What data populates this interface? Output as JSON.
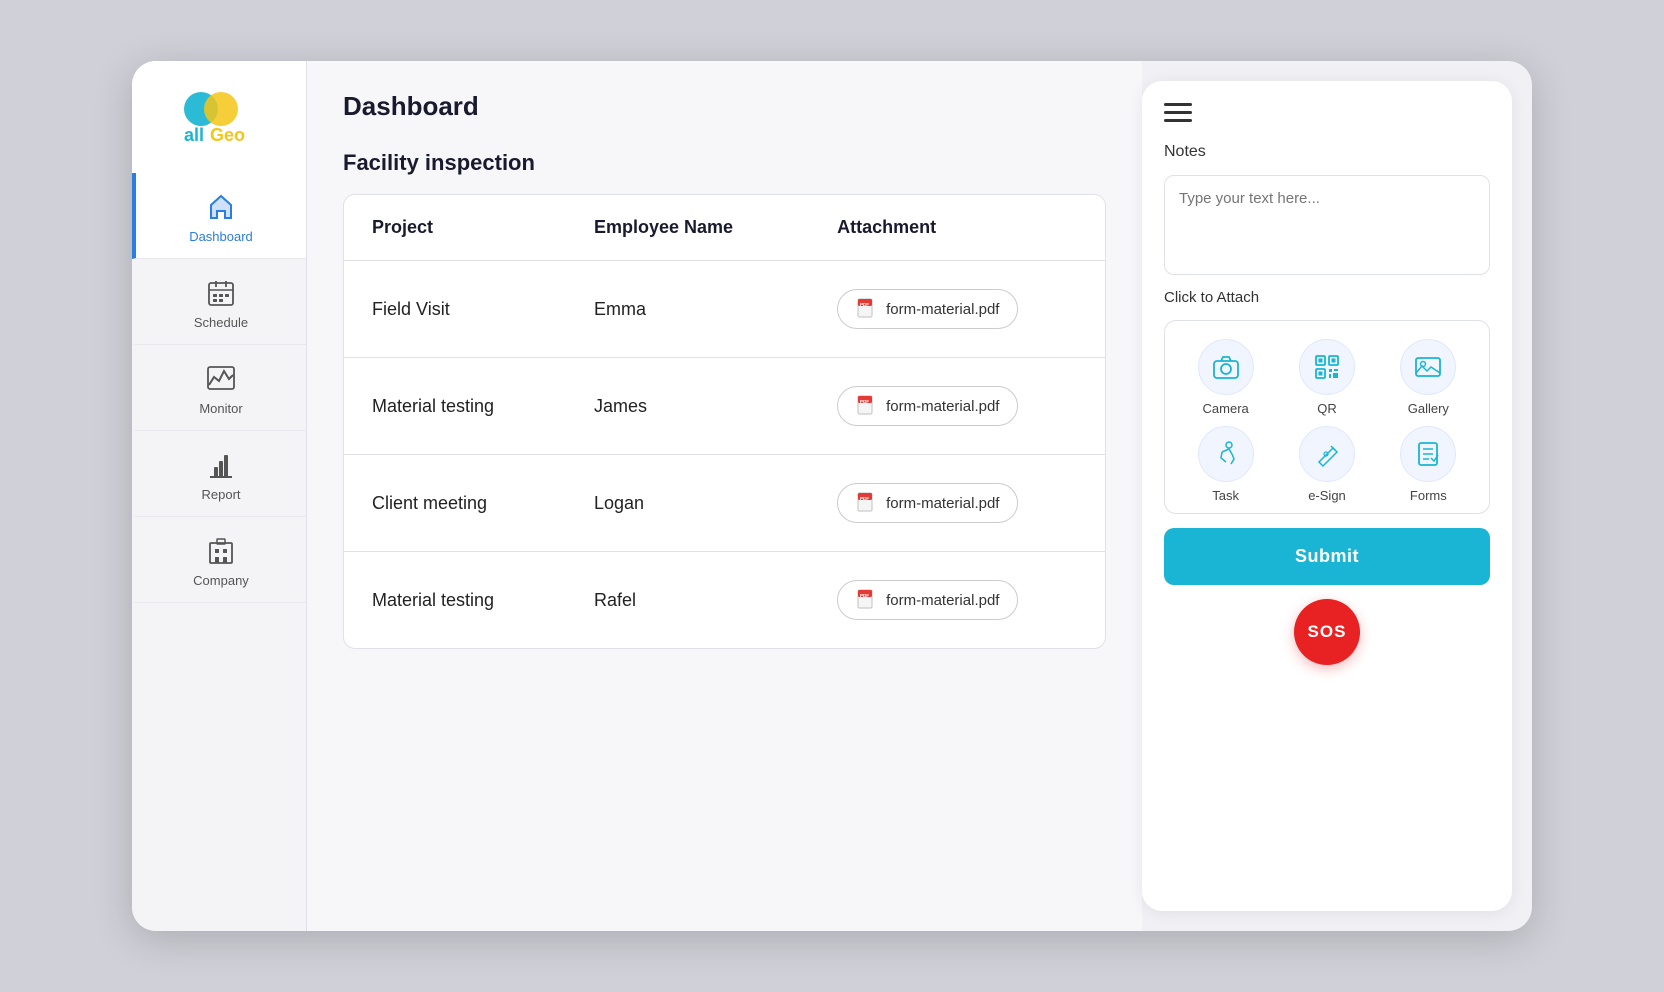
{
  "app": {
    "title": "allGeo"
  },
  "sidebar": {
    "items": [
      {
        "id": "dashboard",
        "label": "Dashboard",
        "active": true
      },
      {
        "id": "schedule",
        "label": "Schedule",
        "active": false
      },
      {
        "id": "monitor",
        "label": "Monitor",
        "active": false
      },
      {
        "id": "report",
        "label": "Report",
        "active": false
      },
      {
        "id": "company",
        "label": "Company",
        "active": false
      }
    ]
  },
  "main": {
    "header": "Dashboard",
    "section_title": "Facility inspection",
    "table": {
      "columns": [
        "Project",
        "Employee Name",
        "Attachment"
      ],
      "rows": [
        {
          "project": "Field Visit",
          "employee": "Emma",
          "attachment": "form-material.pdf"
        },
        {
          "project": "Material testing",
          "employee": "James",
          "attachment": "form-material.pdf"
        },
        {
          "project": "Client meeting",
          "employee": "Logan",
          "attachment": "form-material.pdf"
        },
        {
          "project": "Material testing",
          "employee": "Rafel",
          "attachment": "form-material.pdf"
        }
      ]
    }
  },
  "panel": {
    "notes_label": "Notes",
    "notes_placeholder": "Type your text here...",
    "attach_label": "Click to Attach",
    "attach_items": [
      {
        "id": "camera",
        "label": "Camera"
      },
      {
        "id": "qr",
        "label": "QR"
      },
      {
        "id": "gallery",
        "label": "Gallery"
      },
      {
        "id": "task",
        "label": "Task"
      },
      {
        "id": "esign",
        "label": "e-Sign"
      },
      {
        "id": "forms",
        "label": "Forms"
      }
    ],
    "submit_label": "Submit",
    "sos_label": "SOS"
  }
}
